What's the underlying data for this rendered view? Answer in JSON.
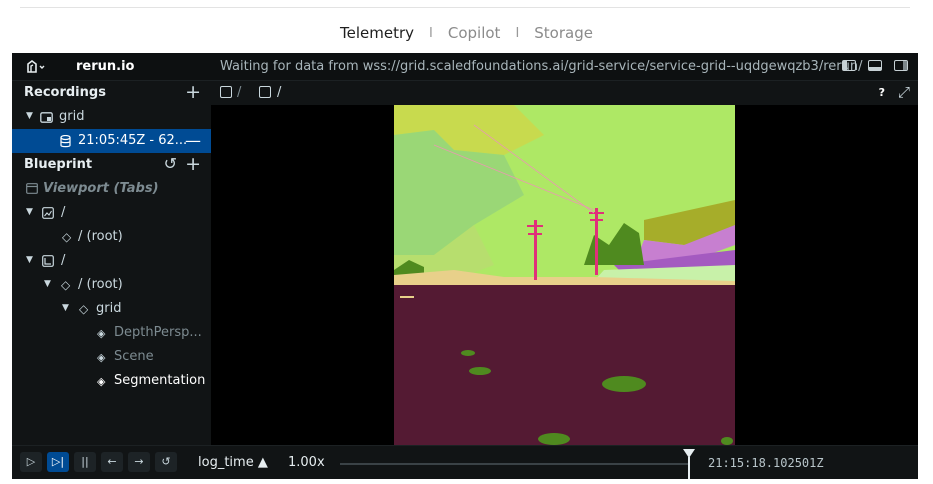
{
  "site_tabs": [
    {
      "label": "Telemetry",
      "active": true
    },
    {
      "label": "Copilot",
      "active": false
    },
    {
      "label": "Storage",
      "active": false
    }
  ],
  "tab_separator": "I",
  "app": {
    "brand": "rerun.io",
    "status": "Waiting for data from wss://grid.scaledfoundations.ai/grid-service/service-grid--uqdgewqzb3/rerun/"
  },
  "recordings": {
    "title": "Recordings",
    "app_item": "grid",
    "recording_item": "21:05:45Z - 62..."
  },
  "blueprint": {
    "title": "Blueprint",
    "viewport": "Viewport (Tabs)",
    "space1": "/",
    "space1_root": "/ (root)",
    "space2": "/",
    "space2_root": "/ (root)",
    "entity_grid": "grid",
    "children": [
      "DepthPersp...",
      "Scene",
      "Segmentation"
    ]
  },
  "viewbar": {
    "tab1": "/",
    "tab2": "/",
    "help": "?"
  },
  "timebar": {
    "timeline": "log_time",
    "speed": "1.00x",
    "timestamp": "21:15:18.102501Z",
    "progress": 0.99
  },
  "colors": {
    "accent": "#004b94",
    "background": "#0d1011",
    "segmentation_ground": "#541a33",
    "segmentation_sky": "#aee865",
    "segmentation_vegetation": "#4f8a1f",
    "segmentation_pole": "#e0307a"
  },
  "icons": {
    "logo": "rerun-logo-icon",
    "recording": "database-icon",
    "viewport": "viewport-icon",
    "space2d": "2d-space-icon",
    "entity": "diamond-icon"
  }
}
